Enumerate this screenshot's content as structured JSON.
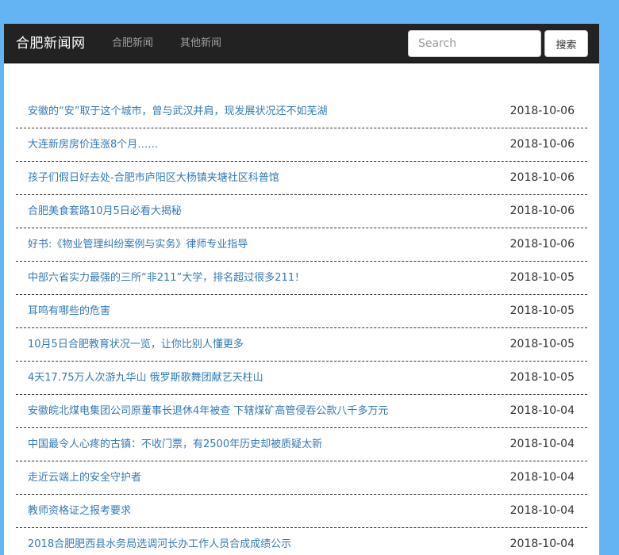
{
  "navbar": {
    "brand": "合肥新闻网",
    "links": [
      {
        "label": "合肥新闻"
      },
      {
        "label": "其他新闻"
      }
    ],
    "search": {
      "placeholder": "Search",
      "value": "",
      "button_label": "搜索"
    }
  },
  "news": [
    {
      "title": "安徽的“安”取于这个城市，曾与武汉并肩，现发展状况还不如芜湖",
      "date": "2018-10-06"
    },
    {
      "title": "大连新房房价连涨8个月……",
      "date": "2018-10-06"
    },
    {
      "title": "孩子们假日好去处-合肥市庐阳区大杨镇夹塘社区科普馆",
      "date": "2018-10-06"
    },
    {
      "title": "合肥美食套路10月5日必看大揭秘",
      "date": "2018-10-06"
    },
    {
      "title": "好书:《物业管理纠纷案例与实务》律师专业指导",
      "date": "2018-10-06"
    },
    {
      "title": "中部六省实力最强的三所“非211”大学，排名超过很多211！",
      "date": "2018-10-05"
    },
    {
      "title": "耳鸣有哪些的危害",
      "date": "2018-10-05"
    },
    {
      "title": "10月5日合肥教育状况一览，让你比别人懂更多",
      "date": "2018-10-05"
    },
    {
      "title": "4天17.75万人次游九华山 俄罗斯歌舞团献艺天柱山",
      "date": "2018-10-05"
    },
    {
      "title": "安徽皖北煤电集团公司原董事长退休4年被查 下辖煤矿高管侵吞公款八千多万元",
      "date": "2018-10-04"
    },
    {
      "title": "中国最令人心疼的古镇：不收门票，有2500年历史却被质疑太新",
      "date": "2018-10-04"
    },
    {
      "title": "走近云端上的安全守护者",
      "date": "2018-10-04"
    },
    {
      "title": "教师资格证之报考要求",
      "date": "2018-10-04"
    },
    {
      "title": "2018合肥肥西县水务局选调河长办工作人员合成成绩公示",
      "date": "2018-10-04"
    }
  ]
}
